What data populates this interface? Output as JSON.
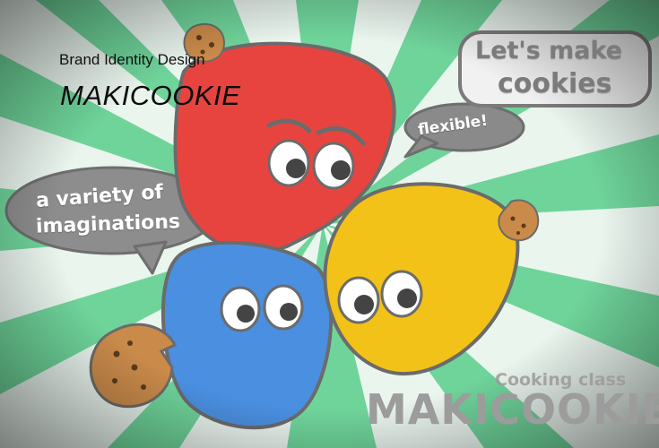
{
  "header": {
    "subtitle": "Brand Identity Design",
    "title": "MAKICOOKIE"
  },
  "speech_bubbles": {
    "flexible": "flexible!",
    "variety_line1": "a variety of",
    "variety_line2": "imaginations",
    "lets_make_line1": "Let's make",
    "lets_make_line2": "cookies"
  },
  "footer": {
    "class_label": "Cooking class",
    "brand": "MAKICOOKIE"
  },
  "colors": {
    "ray_green": "#6fd49a",
    "ray_white": "#eaf5ee",
    "char_red": "#e8443f",
    "char_blue": "#4a8fe0",
    "char_yellow": "#f3c218",
    "outline": "#6b6b6b",
    "cookie": "#c98a4a",
    "bubble_gray": "#8a8a8a"
  },
  "characters": [
    "red-character",
    "blue-character",
    "yellow-character"
  ]
}
